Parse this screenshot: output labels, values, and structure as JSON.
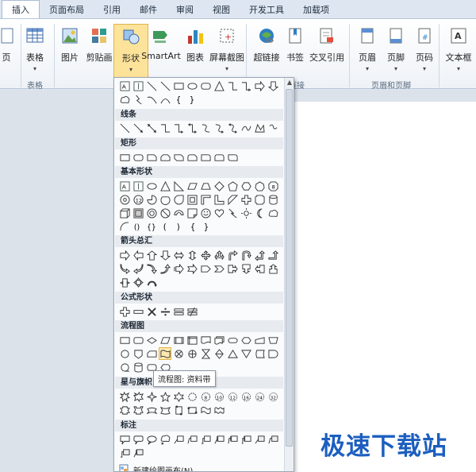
{
  "tabs": [
    {
      "label": "插入",
      "active": true
    },
    {
      "label": "页面布局"
    },
    {
      "label": "引用"
    },
    {
      "label": "邮件"
    },
    {
      "label": "审阅"
    },
    {
      "label": "视图"
    },
    {
      "label": "开发工具"
    },
    {
      "label": "加载项"
    }
  ],
  "ribbon": {
    "buttons": [
      {
        "label": "页",
        "icon": "page-icon"
      },
      {
        "label": "表格",
        "icon": "table-icon",
        "arrow": "▾"
      },
      {
        "label": "图片",
        "icon": "picture-icon"
      },
      {
        "label": "剪贴画",
        "icon": "clipart-icon"
      },
      {
        "label": "形状",
        "icon": "shapes-icon",
        "arrow": "▾"
      },
      {
        "label": "SmartArt",
        "icon": "smartart-icon"
      },
      {
        "label": "图表",
        "icon": "chart-icon"
      },
      {
        "label": "屏幕截图",
        "icon": "screenshot-icon",
        "arrow": "▾"
      },
      {
        "label": "超链接",
        "icon": "hyperlink-icon"
      },
      {
        "label": "书签",
        "icon": "bookmark-icon"
      },
      {
        "label": "交叉引用",
        "icon": "crossref-icon"
      },
      {
        "label": "页眉",
        "icon": "header-icon",
        "arrow": "▾"
      },
      {
        "label": "页脚",
        "icon": "footer-icon",
        "arrow": "▾"
      },
      {
        "label": "页码",
        "icon": "pagenum-icon",
        "arrow": "▾"
      },
      {
        "label": "文本框",
        "icon": "textbox-icon",
        "arrow": "▾"
      }
    ],
    "group_labels": {
      "tables": "表格",
      "links": "链接",
      "header_footer": "页眉和页脚"
    }
  },
  "shapes_menu": {
    "sections": [
      {
        "title": "线条"
      },
      {
        "title": "矩形"
      },
      {
        "title": "基本形状"
      },
      {
        "title": "箭头总汇"
      },
      {
        "title": "公式形状"
      },
      {
        "title": "流程图"
      },
      {
        "title": "星与旗帜"
      },
      {
        "title": "标注"
      }
    ],
    "tooltip": "流程图: 资料带",
    "footer": "新建绘图画布(N)"
  },
  "watermark": "极速下载站",
  "colors": {
    "accent": "#fde39a",
    "watermark": "#1c5fbf"
  }
}
